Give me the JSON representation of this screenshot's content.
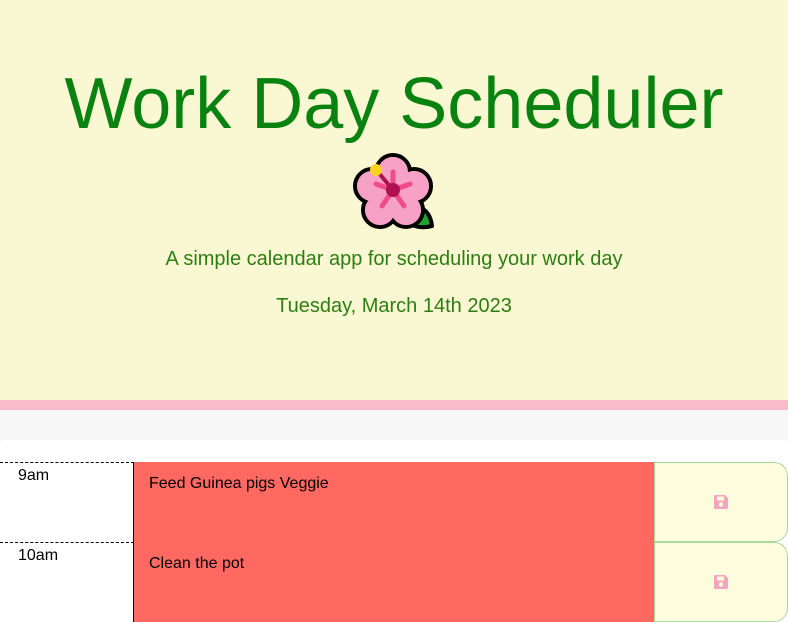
{
  "header": {
    "title": "Work Day Scheduler",
    "subtitle": "A simple calendar app for scheduling your work day",
    "current_day": "Tuesday, March 14th 2023",
    "emoji_icon": "hibiscus-flower-icon"
  },
  "colors": {
    "header_bg": "#f9f8d3",
    "title": "#0a8210",
    "divider": "#f8bbc8",
    "past_block": "#ff6961",
    "save_bg": "#fffddd",
    "save_icon": "#f3a6c0"
  },
  "timeblocks": [
    {
      "hour": "9am",
      "description": "Feed Guinea pigs Veggie",
      "save_icon": "floppy-disk-icon"
    },
    {
      "hour": "10am",
      "description": "Clean the pot",
      "save_icon": "floppy-disk-icon"
    }
  ]
}
